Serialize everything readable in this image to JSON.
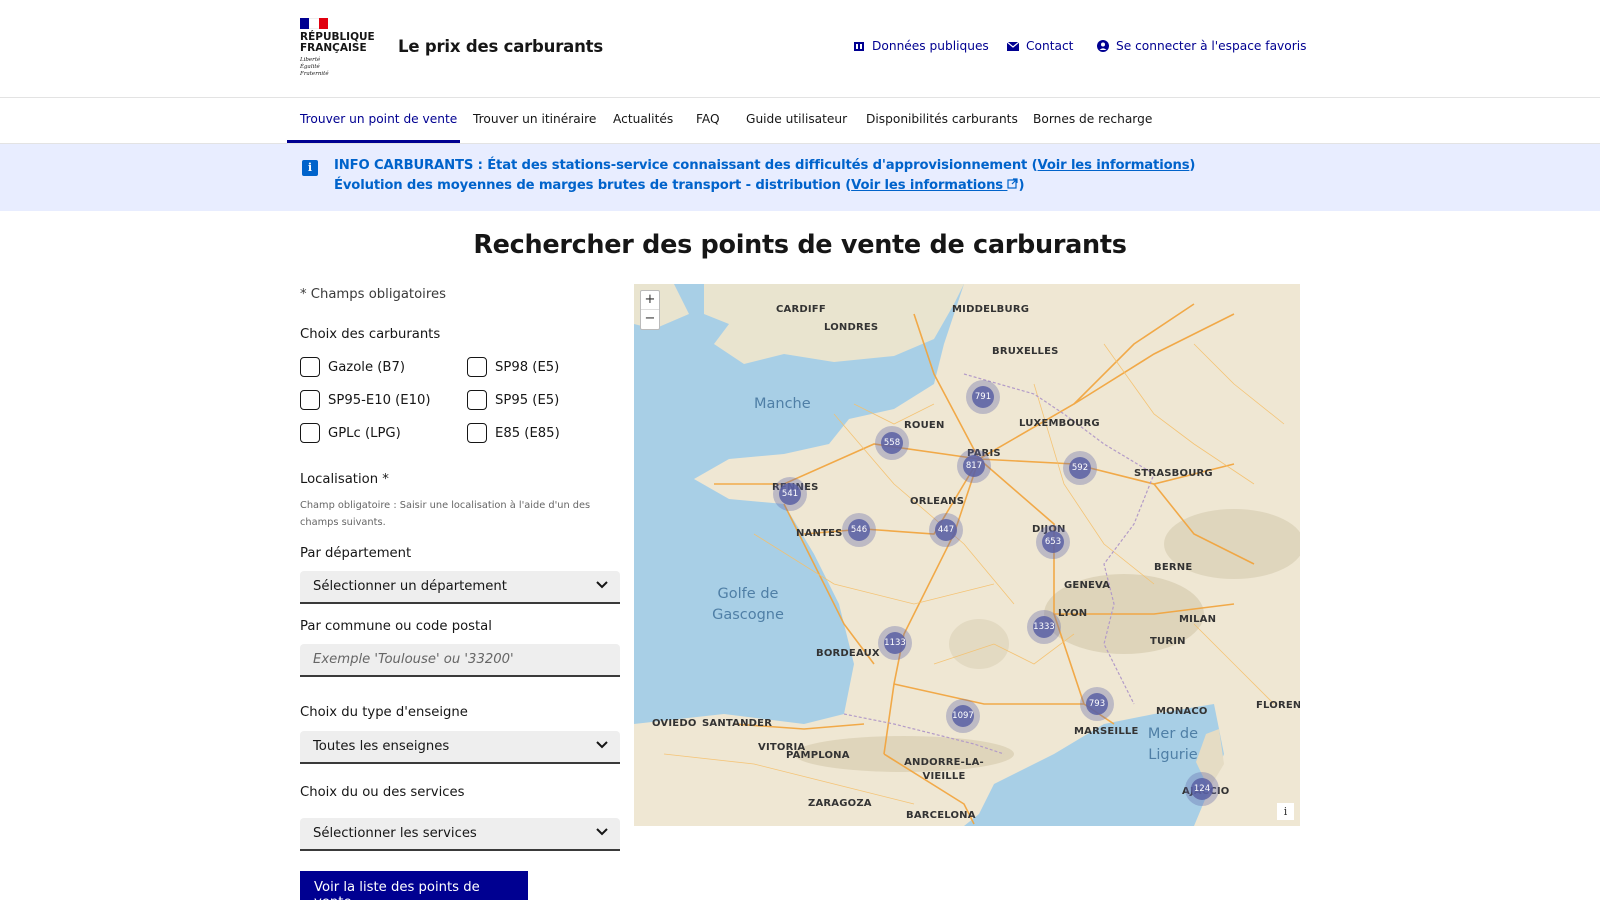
{
  "header": {
    "logo_lines": [
      "RÉPUBLIQUE",
      "FRANÇAISE"
    ],
    "devise": [
      "Liberté",
      "Égalité",
      "Fraternité"
    ],
    "site_title": "Le prix des carburants",
    "tools": {
      "donnees": "Données publiques",
      "contact": "Contact",
      "connexion": "Se connecter à l'espace favoris"
    },
    "flag_colors": [
      "#000091",
      "#ffffff",
      "#e1000f"
    ]
  },
  "nav": {
    "items": [
      "Trouver un point de vente",
      "Trouver un itinéraire",
      "Actualités",
      "FAQ",
      "Guide utilisateur",
      "Disponibilités carburants",
      "Bornes de recharge"
    ],
    "active_index": 0
  },
  "notice": {
    "icon": "info-icon",
    "line1_text": "INFO CARBURANTS : État des stations-service connaissant des difficultés d'approvisionnement (",
    "line1_link": "Voir les informations",
    "line1_end": ")",
    "line2_text": "Évolution des moyennes de marges brutes de transport - distribution (",
    "line2_link": "Voir les informations",
    "line2_end": ")"
  },
  "page_title": "Rechercher des points de vente de carburants",
  "form": {
    "required_note": "* Champs obligatoires",
    "fuel_heading": "Choix des carburants",
    "fuels": [
      "Gazole (B7)",
      "SP98 (E5)",
      "SP95-E10 (E10)",
      "SP95 (E5)",
      "GPLc (LPG)",
      "E85 (E85)"
    ],
    "localisation_label": "Localisation *",
    "localisation_hint": "Champ obligatoire : Saisir une localisation à l'aide d'un des champs suivants.",
    "departement_label": "Par département",
    "departement_value": "Sélectionner un département",
    "commune_label": "Par commune ou code postal",
    "commune_placeholder": "Exemple 'Toulouse' ou '33200'",
    "enseigne_label": "Choix du type d'enseigne",
    "enseigne_value": "Toutes les enseignes",
    "services_label": "Choix du ou des services",
    "services_value": "Sélectionner les services",
    "submit_label": "Voir la liste des points de vente"
  },
  "map": {
    "zoom_in": "+",
    "zoom_out": "−",
    "info": "i",
    "seas": [
      "Manche",
      "Golfe de Gascogne",
      "Mer de Ligurie"
    ],
    "cities": [
      "CARDIFF",
      "LONDRES",
      "MIDDELBURG",
      "BRUXELLES",
      "LUXEMBOURG",
      "PARIS",
      "ROUEN",
      "RENNES",
      "NANTES",
      "ORLEANS",
      "DIJON",
      "LYON",
      "BORDEAUX",
      "TURIN",
      "GENEVA",
      "MONACO",
      "MARSEILLE",
      "ANDORRE-LA-VIEILLE",
      "BARCELONA",
      "ZARAGOZA",
      "PAMPLONA",
      "VITORIA",
      "OVIEDO",
      "SANTANDER",
      "STRASBOURG",
      "BERNE",
      "MILAN",
      "AJACCIO",
      "FLORENCE"
    ],
    "clusters": [
      {
        "label": "791"
      },
      {
        "label": "558"
      },
      {
        "label": "817"
      },
      {
        "label": "592"
      },
      {
        "label": "541"
      },
      {
        "label": "546"
      },
      {
        "label": "447"
      },
      {
        "label": "653"
      },
      {
        "label": "1133"
      },
      {
        "label": "1333"
      },
      {
        "label": "793"
      },
      {
        "label": "1097"
      },
      {
        "label": "124"
      }
    ],
    "colors": {
      "sea": "#a8cfe6",
      "land": "#efe7d3",
      "road": "#f2a33a",
      "cluster": "#5a60a5"
    }
  }
}
